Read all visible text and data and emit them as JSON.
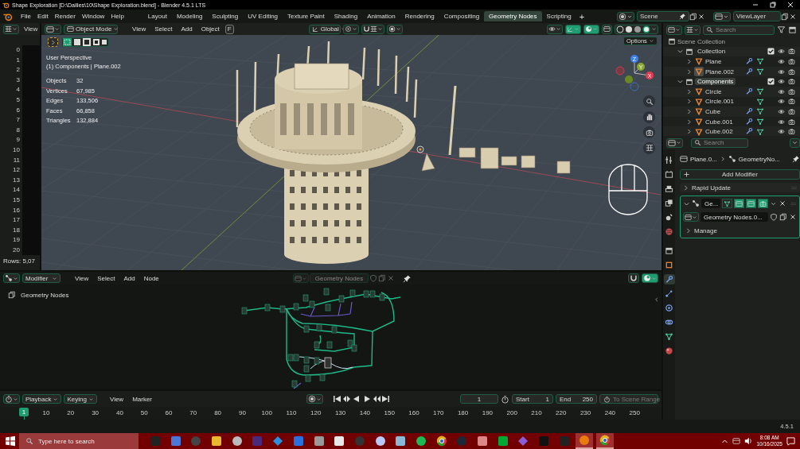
{
  "title_bar": {
    "title": "Shape Exploration [D:\\Dailies\\10\\Shape Exploration.blend] - Blender 4.5.1 LTS"
  },
  "menu": [
    "File",
    "Edit",
    "Render",
    "Window",
    "Help"
  ],
  "workspaces": [
    {
      "label": "Layout",
      "selected": false
    },
    {
      "label": "Modeling",
      "selected": false
    },
    {
      "label": "Sculpting",
      "selected": false
    },
    {
      "label": "UV Editing",
      "selected": false
    },
    {
      "label": "Texture Paint",
      "selected": false
    },
    {
      "label": "Shading",
      "selected": false
    },
    {
      "label": "Animation",
      "selected": false
    },
    {
      "label": "Rendering",
      "selected": false
    },
    {
      "label": "Compositing",
      "selected": false
    },
    {
      "label": "Geometry Nodes",
      "selected": true
    },
    {
      "label": "Scripting",
      "selected": false
    }
  ],
  "add_workspace": "+",
  "scene": "Scene",
  "view_layer": "ViewLayer",
  "spreadsheet": {
    "menu": "View",
    "rows": [
      "0",
      "1",
      "2",
      "3",
      "4",
      "5",
      "6",
      "7",
      "8",
      "9",
      "10",
      "11",
      "12",
      "13",
      "14",
      "15",
      "16",
      "17",
      "18",
      "19",
      "20"
    ],
    "footer": "Rows: 5,07"
  },
  "viewport": {
    "mode": "Object Mode",
    "menus": [
      "View",
      "Select",
      "Add",
      "Object"
    ],
    "shortcut": "F",
    "orientation": "Global",
    "options": "Options",
    "view_name": "User Perspective",
    "context": "(1) Components | Plane.002",
    "stats": [
      {
        "label": "Objects",
        "value": "32"
      },
      {
        "label": "Vertices",
        "value": "67,985"
      },
      {
        "label": "Edges",
        "value": "133,506"
      },
      {
        "label": "Faces",
        "value": "66,858"
      },
      {
        "label": "Triangles",
        "value": "132,884"
      }
    ],
    "gizmo_axes": [
      "Z",
      "Y",
      "X"
    ],
    "gizmos_on": true,
    "overlays_on": true
  },
  "outliner": {
    "search_placeholder": "Search",
    "tree": [
      {
        "kind": "scene",
        "name": "Scene Collection",
        "children": [
          {
            "kind": "collection",
            "name": "Collection",
            "expanded": true,
            "checked": true,
            "selected": false,
            "children": [
              {
                "kind": "object",
                "name": "Plane",
                "expanded": false,
                "selected": false,
                "modifier": true
              },
              {
                "kind": "object",
                "name": "Plane.002",
                "expanded": false,
                "selected": true,
                "modifier": true
              }
            ]
          },
          {
            "kind": "collection",
            "name": "Components",
            "expanded": true,
            "checked": true,
            "selected": true,
            "children": [
              {
                "kind": "object",
                "name": "Circle",
                "expanded": false,
                "selected": false,
                "modifier": true
              },
              {
                "kind": "object",
                "name": "Circle.001",
                "expanded": false,
                "selected": false,
                "modifier": false
              },
              {
                "kind": "object",
                "name": "Cube",
                "expanded": false,
                "selected": false,
                "modifier": true
              },
              {
                "kind": "object",
                "name": "Cube.001",
                "expanded": false,
                "selected": false,
                "modifier": true
              },
              {
                "kind": "object",
                "name": "Cube.002",
                "expanded": false,
                "selected": false,
                "modifier": true
              }
            ]
          }
        ]
      }
    ]
  },
  "properties": {
    "search_placeholder": "Search",
    "tabs": [
      {
        "kind": "tool",
        "selected": false
      },
      {
        "kind": "render",
        "selected": false
      },
      {
        "kind": "output",
        "selected": false
      },
      {
        "kind": "view-layer",
        "selected": false
      },
      {
        "kind": "scene",
        "selected": false
      },
      {
        "kind": "world",
        "selected": false
      },
      {
        "kind": "collection",
        "selected": false
      },
      {
        "kind": "object",
        "selected": false
      },
      {
        "kind": "modifier",
        "selected": true
      },
      {
        "kind": "particles",
        "selected": false
      },
      {
        "kind": "physics",
        "selected": false
      },
      {
        "kind": "constraints",
        "selected": false
      },
      {
        "kind": "data",
        "selected": false
      },
      {
        "kind": "material",
        "selected": false
      }
    ],
    "object": "Plane.0...",
    "modifier_path": "GeometryNo...",
    "add_modifier": "Add Modifier",
    "modifiers": [
      {
        "kind": "panel",
        "name": "Rapid Update",
        "expanded": false
      },
      {
        "kind": "geometry-nodes",
        "name": "Ge...",
        "expanded": true,
        "on_cage": false,
        "edit_mode": true,
        "viewport": true,
        "render": true,
        "node_group": "Geometry Nodes.0...",
        "subpanel": "Manage",
        "subpanel_expanded": false
      }
    ]
  },
  "node_editor": {
    "context": "Modifier",
    "menus": [
      "View",
      "Select",
      "Add",
      "Node"
    ],
    "node_group": "Geometry Nodes",
    "breadcrumb": "Geometry Nodes",
    "overlays_on": true
  },
  "timeline": {
    "dropdowns": [
      "Playback",
      "Keying"
    ],
    "menus": [
      "View",
      "Marker"
    ],
    "current_frame": "1",
    "start_label": "Start",
    "start": "1",
    "end_label": "End",
    "end": "250",
    "range_button": "To Scene Range",
    "playhead": "1",
    "ticks": [
      "10",
      "20",
      "30",
      "40",
      "50",
      "60",
      "70",
      "80",
      "90",
      "100",
      "110",
      "120",
      "130",
      "140",
      "150",
      "160",
      "170",
      "180",
      "190",
      "200",
      "210",
      "220",
      "230",
      "240",
      "250"
    ]
  },
  "status_bar": {
    "version": "4.5.1"
  },
  "taskbar": {
    "search_placeholder": "Type here to search",
    "apps": [
      {
        "kind": "terminal",
        "open": false
      },
      {
        "kind": "calculator",
        "open": false
      },
      {
        "kind": "recorder",
        "open": false
      },
      {
        "kind": "folder",
        "open": false
      },
      {
        "kind": "camera",
        "open": false
      },
      {
        "kind": "video",
        "open": false
      },
      {
        "kind": "diamond",
        "open": false
      },
      {
        "kind": "captions",
        "open": false
      },
      {
        "kind": "cube",
        "open": false
      },
      {
        "kind": "monitor",
        "open": false
      },
      {
        "kind": "wolf",
        "open": false
      },
      {
        "kind": "paint",
        "open": false
      },
      {
        "kind": "notes",
        "open": false
      },
      {
        "kind": "music",
        "open": false
      },
      {
        "kind": "browser",
        "open": false
      },
      {
        "kind": "game",
        "open": false
      },
      {
        "kind": "photo",
        "open": false
      },
      {
        "kind": "texture",
        "open": false
      },
      {
        "kind": "crystal",
        "open": false
      },
      {
        "kind": "box",
        "open": false
      },
      {
        "kind": "store",
        "open": false
      },
      {
        "kind": "blender",
        "open": true
      },
      {
        "kind": "browser",
        "open": true
      }
    ],
    "time": "8:08 AM",
    "date": "10/16/2025"
  }
}
